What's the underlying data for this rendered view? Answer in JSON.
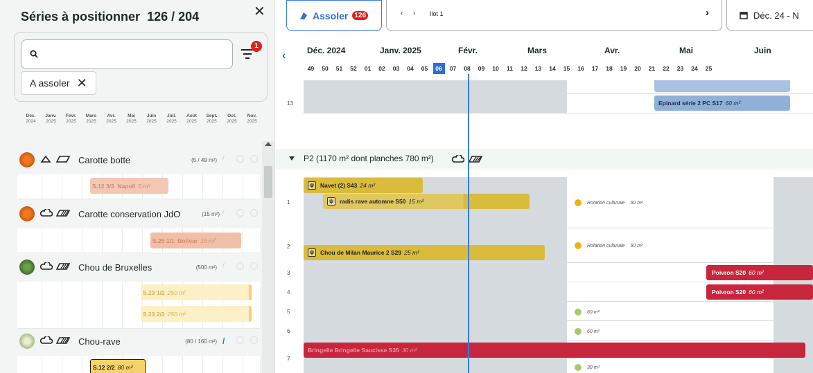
{
  "left_panel": {
    "title": "Séries à positionner",
    "count": "126 / 204",
    "search_placeholder": "",
    "filter_badge": "1",
    "chip_label": "A assoler",
    "mini_months": [
      {
        "m": "Déc.",
        "y": "2024"
      },
      {
        "m": "Janv.",
        "y": "2025"
      },
      {
        "m": "Févr.",
        "y": "2025"
      },
      {
        "m": "Mars",
        "y": "2025"
      },
      {
        "m": "Avr.",
        "y": "2025"
      },
      {
        "m": "Mai",
        "y": "2025"
      },
      {
        "m": "Juin",
        "y": "2025"
      },
      {
        "m": "Juil.",
        "y": "2025"
      },
      {
        "m": "Août",
        "y": "2025"
      },
      {
        "m": "Sept.",
        "y": "2025"
      },
      {
        "m": "Oct.",
        "y": "2025"
      },
      {
        "m": "Nov.",
        "y": "2025"
      }
    ],
    "crops": [
      {
        "name": "Carotte botte",
        "area": "(5 / 49 m²)",
        "series": [
          {
            "label": "S.12 3/3",
            "variety": "Napoli",
            "qty": "5 m²"
          }
        ]
      },
      {
        "name": "Carotte conservation JdO",
        "area": "(15 m²)",
        "series": [
          {
            "label": "S.25 1/1",
            "variety": "Bolivar",
            "qty": "15 m²"
          }
        ]
      },
      {
        "name": "Chou de Bruxelles",
        "area": "(500 m²)",
        "series": [
          {
            "label": "S.23 1/2",
            "variety": "",
            "qty": "250 m²"
          },
          {
            "label": "S.23 2/2",
            "variety": "",
            "qty": "250 m²"
          }
        ]
      },
      {
        "name": "Chou-rave",
        "area": "(80 / 160 m²)",
        "series": [
          {
            "label": "S.12 2/2",
            "variety": "",
            "qty": "80 m²"
          }
        ]
      }
    ]
  },
  "toolbar": {
    "assoler_label": "Assoler",
    "assoler_badge": "126",
    "ilot_label": "Ilot 1",
    "date_range": "Déc. 24 - N"
  },
  "timeline": {
    "months": [
      "Déc. 2024",
      "Janv. 2025",
      "Févr.",
      "Mars",
      "Avr.",
      "Mai",
      "Juin"
    ],
    "weeks": [
      "49",
      "50",
      "51",
      "52",
      "01",
      "02",
      "03",
      "04",
      "05",
      "06",
      "07",
      "08",
      "09",
      "10",
      "11",
      "12",
      "13",
      "14",
      "15",
      "16",
      "17",
      "18",
      "19",
      "20",
      "21",
      "22",
      "23",
      "24",
      "25"
    ],
    "current_week": "06"
  },
  "plots": {
    "row13_label": "13",
    "row13_block": {
      "label": "Epinard série 2 PC S17",
      "qty": "60 m²"
    },
    "p2_label": "P2 (1170 m² dont planches 780 m²)",
    "rows": [
      "1",
      "2",
      "3",
      "4",
      "5",
      "6",
      "7"
    ],
    "blocks": [
      {
        "label": "Navet (2) S43",
        "qty": "24 m²"
      },
      {
        "label": "radis rave automne S50",
        "qty": "15 m²"
      },
      {
        "label": "Chou de Milan Maurice 2 S29",
        "qty": "25 m²"
      },
      {
        "label": "Poivron S20",
        "qty": "60 m²"
      },
      {
        "label": "Poivron S20",
        "qty": "60 m²"
      },
      {
        "label": "Bringelle Bringelle Saucisse S35",
        "qty": "30 m²"
      }
    ],
    "warnings": [
      {
        "text": "Rotation culturale",
        "qty": "60 m²"
      },
      {
        "text": "Rotation culturale",
        "qty": "60 m²"
      },
      {
        "text": "",
        "qty": "60 m²"
      },
      {
        "text": "",
        "qty": "60 m²"
      },
      {
        "text": "",
        "qty": "30 m²"
      }
    ]
  },
  "colors": {
    "accent": "#2b6fd6",
    "badge": "#e02020",
    "yellow": "#d9bc3c",
    "red": "#c8263d",
    "blue_block": "#8fb0d9",
    "shade": "#d5dade"
  }
}
